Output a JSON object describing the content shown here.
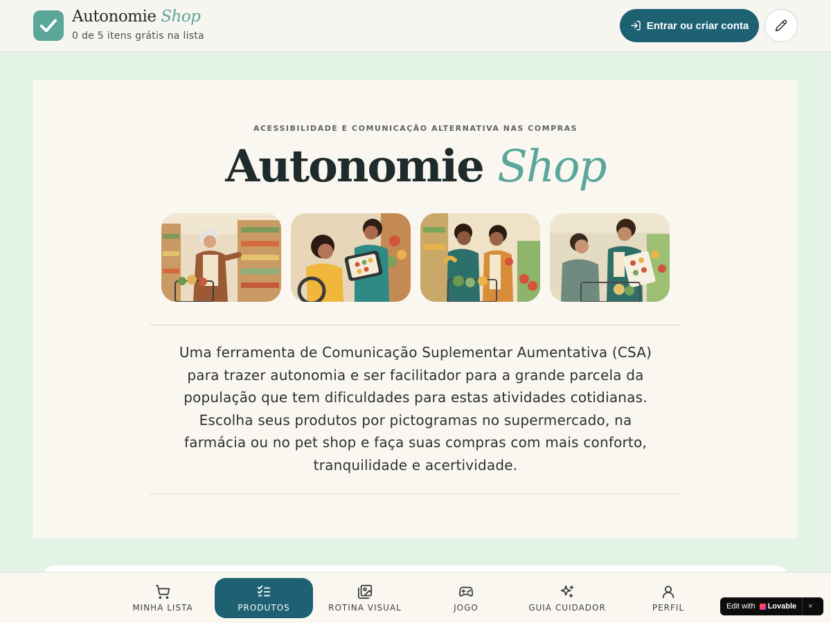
{
  "header": {
    "brand_main": "Autonomie",
    "brand_accent": "Shop",
    "subtitle": "0 de 5 itens grátis na lista",
    "login_label": "Entrar ou criar conta",
    "edit_icon": "pencil-icon",
    "logo_icon": "check-icon"
  },
  "hero": {
    "eyebrow": "ACESSIBILIDADE E COMUNICAÇÃO ALTERNATIVA NAS COMPRAS",
    "title_main": "Autonomie",
    "title_accent": "Shop",
    "description": "Uma ferramenta de Comunicação Suplementar Aumentativa (CSA) para trazer autonomia e ser facilitador para a grande parcela da população que tem dificuldades para estas atividades cotidianas. Escolha seus produtos por pictogramas no supermercado, na farmácia ou no pet shop e faça suas compras com mais conforto, tranquilidade e acertividade."
  },
  "nav": {
    "items": [
      {
        "label": "MINHA LISTA",
        "icon": "cart-icon"
      },
      {
        "label": "PRODUTOS",
        "icon": "checklist-icon",
        "active": true
      },
      {
        "label": "ROTINA VISUAL",
        "icon": "images-icon"
      },
      {
        "label": "JOGO",
        "icon": "gamepad-icon"
      },
      {
        "label": "GUIA CUIDADOR",
        "icon": "sparkles-icon"
      },
      {
        "label": "PERFIL",
        "icon": "user-icon"
      }
    ]
  },
  "lovable": {
    "prefix": "Edit with",
    "brand": "Lovable",
    "close": "×"
  },
  "colors": {
    "accent": "#5aa69a",
    "primary": "#1d6173",
    "background": "#e3f3e6",
    "card": "#faf7f1"
  }
}
